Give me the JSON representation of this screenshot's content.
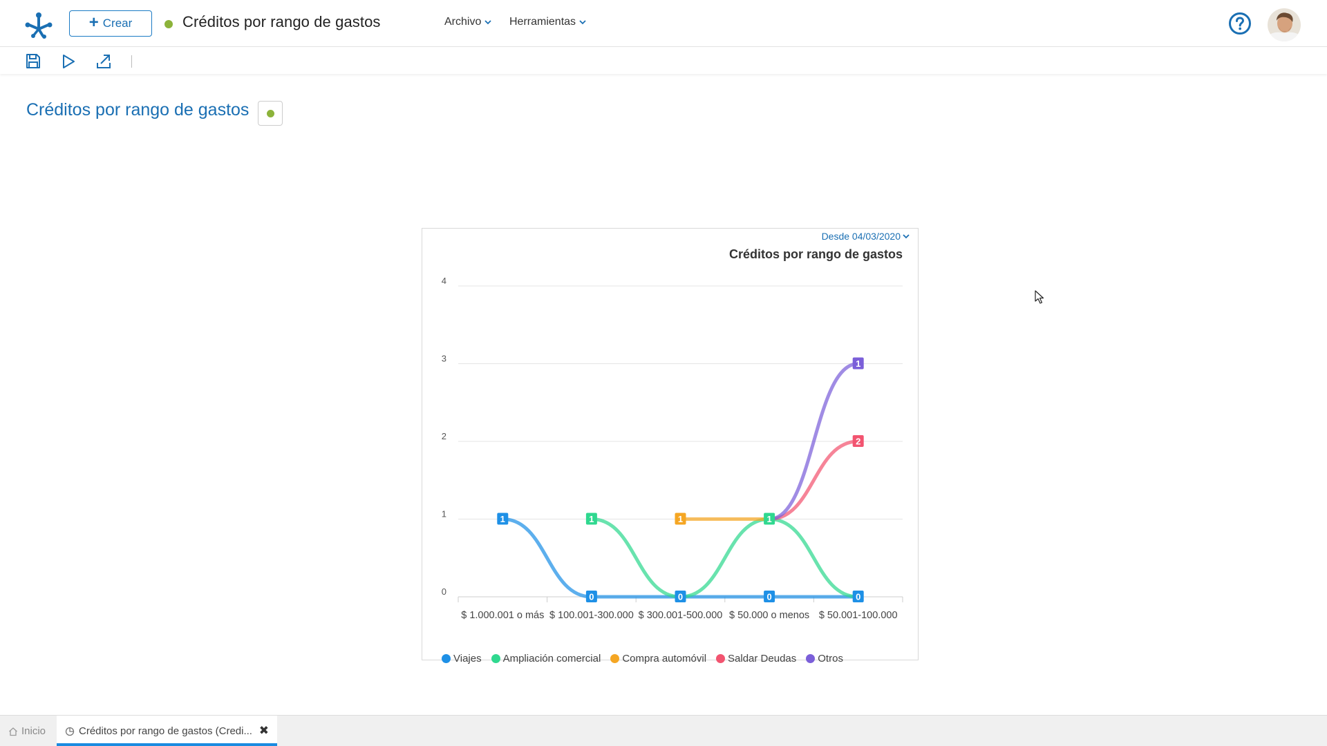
{
  "header": {
    "create_label": "Crear",
    "title": "Créditos por rango de gastos",
    "status_color": "#8cb33a",
    "menus": [
      {
        "label": "Archivo"
      },
      {
        "label": "Herramientas"
      }
    ],
    "icons": {
      "logo": "app-logo-icon",
      "help": "help-circle-icon",
      "avatar": "user-avatar"
    }
  },
  "toolbar": {
    "icons": [
      "save-icon",
      "run-icon",
      "export-icon"
    ]
  },
  "page": {
    "title": "Créditos por rango de gastos",
    "state_color": "#8cb33a"
  },
  "chart_card": {
    "since_label": "Desde 04/03/2020",
    "title": "Créditos por rango de gastos"
  },
  "chart_data": {
    "type": "line",
    "title": "Créditos por rango de gastos",
    "xlabel": "",
    "ylabel": "",
    "ylim": [
      0,
      4
    ],
    "yticks": [
      "0",
      "1",
      "2",
      "3",
      "4"
    ],
    "grid": true,
    "legend_position": "bottom",
    "categories": [
      "$ 1.000.001 o más",
      "$ 100.001-300.000",
      "$ 300.001-500.000",
      "$ 50.000 o menos",
      "$ 50.001-100.000"
    ],
    "series": [
      {
        "name": "Viajes",
        "color": "#1e90e6",
        "values": [
          1,
          0,
          0,
          0,
          0
        ]
      },
      {
        "name": "Ampliación comercial",
        "color": "#2fd88f",
        "values": [
          null,
          1,
          0,
          1,
          0
        ]
      },
      {
        "name": "Compra automóvil",
        "color": "#f5a623",
        "values": [
          null,
          null,
          1,
          1,
          null
        ]
      },
      {
        "name": "Saldar Deudas",
        "color": "#f25470",
        "values": [
          null,
          null,
          null,
          1,
          2
        ]
      },
      {
        "name": "Otros",
        "color": "#7b5fd9",
        "values": [
          null,
          null,
          null,
          1,
          3
        ]
      }
    ],
    "data_labels": [
      {
        "category": 0,
        "value": 1,
        "text": "1",
        "color": "#1e90e6"
      },
      {
        "category": 1,
        "value": 1,
        "text": "1",
        "color": "#2fd88f"
      },
      {
        "category": 2,
        "value": 1,
        "text": "1",
        "color": "#f5a623"
      },
      {
        "category": 3,
        "value": 1,
        "text": "1",
        "color": "#2fd88f"
      },
      {
        "category": 4,
        "value": 3,
        "text": "1",
        "color": "#7b5fd9"
      },
      {
        "category": 4,
        "value": 2,
        "text": "2",
        "color": "#f25470"
      },
      {
        "category": 1,
        "value": 0,
        "text": "0",
        "color": "#1e90e6"
      },
      {
        "category": 2,
        "value": 0,
        "text": "0",
        "color": "#1e90e6"
      },
      {
        "category": 3,
        "value": 0,
        "text": "0",
        "color": "#1e90e6"
      },
      {
        "category": 4,
        "value": 0,
        "text": "0",
        "color": "#1e90e6"
      }
    ]
  },
  "bottom_tabs": [
    {
      "label": "Inicio"
    },
    {
      "label": "Créditos por rango de gastos (Credi..."
    }
  ]
}
